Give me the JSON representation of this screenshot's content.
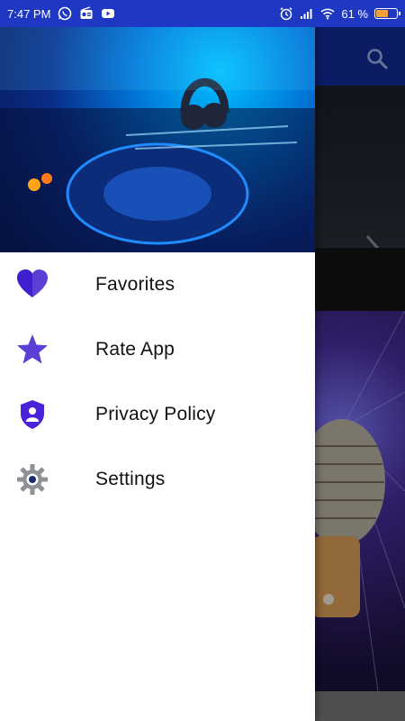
{
  "status_bar": {
    "time": "7:47 PM",
    "battery_text": "61 %",
    "battery_level": 0.61
  },
  "drawer": {
    "items": [
      {
        "label": "Favorites",
        "icon": "heart-icon"
      },
      {
        "label": "Rate App",
        "icon": "star-icon"
      },
      {
        "label": "Privacy Policy",
        "icon": "shield-user-icon"
      },
      {
        "label": "Settings",
        "icon": "gear-icon"
      }
    ]
  },
  "colors": {
    "status_bar": "#1f38c4",
    "toolbar": "#122a9a",
    "accent_purple": "#5b3fd6"
  }
}
